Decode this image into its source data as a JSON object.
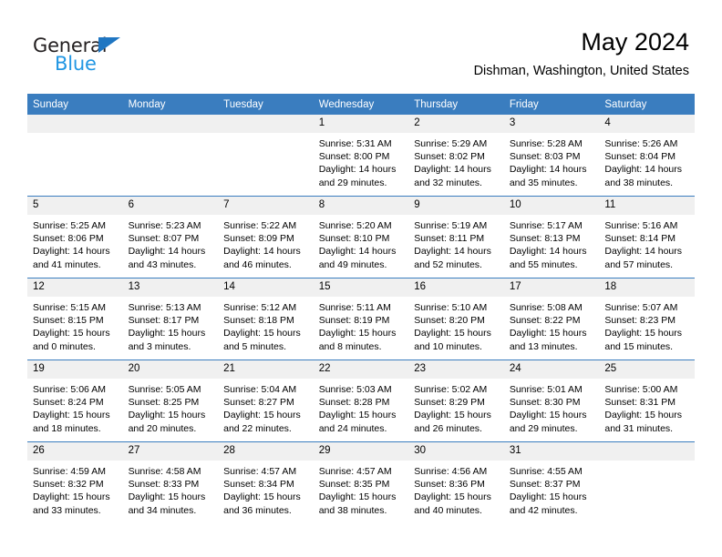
{
  "logo": {
    "text_primary": "General",
    "text_secondary": "Blue",
    "triangle_color": "#1f76c2",
    "secondary_color": "#2196e3"
  },
  "header": {
    "title": "May 2024",
    "subtitle": "Dishman, Washington, United States"
  },
  "theme": {
    "header_row_bg": "#3a7dbf",
    "day_number_bg": "#f0f0f0",
    "grid_line": "#3a7dbf",
    "text": "#000000"
  },
  "calendar": {
    "weekday_headers": [
      "Sunday",
      "Monday",
      "Tuesday",
      "Wednesday",
      "Thursday",
      "Friday",
      "Saturday"
    ],
    "weeks": [
      [
        {
          "day": "",
          "sunrise": "",
          "sunset": "",
          "daylight_line1": "",
          "daylight_line2": ""
        },
        {
          "day": "",
          "sunrise": "",
          "sunset": "",
          "daylight_line1": "",
          "daylight_line2": ""
        },
        {
          "day": "",
          "sunrise": "",
          "sunset": "",
          "daylight_line1": "",
          "daylight_line2": ""
        },
        {
          "day": "1",
          "sunrise": "Sunrise: 5:31 AM",
          "sunset": "Sunset: 8:00 PM",
          "daylight_line1": "Daylight: 14 hours",
          "daylight_line2": "and 29 minutes."
        },
        {
          "day": "2",
          "sunrise": "Sunrise: 5:29 AM",
          "sunset": "Sunset: 8:02 PM",
          "daylight_line1": "Daylight: 14 hours",
          "daylight_line2": "and 32 minutes."
        },
        {
          "day": "3",
          "sunrise": "Sunrise: 5:28 AM",
          "sunset": "Sunset: 8:03 PM",
          "daylight_line1": "Daylight: 14 hours",
          "daylight_line2": "and 35 minutes."
        },
        {
          "day": "4",
          "sunrise": "Sunrise: 5:26 AM",
          "sunset": "Sunset: 8:04 PM",
          "daylight_line1": "Daylight: 14 hours",
          "daylight_line2": "and 38 minutes."
        }
      ],
      [
        {
          "day": "5",
          "sunrise": "Sunrise: 5:25 AM",
          "sunset": "Sunset: 8:06 PM",
          "daylight_line1": "Daylight: 14 hours",
          "daylight_line2": "and 41 minutes."
        },
        {
          "day": "6",
          "sunrise": "Sunrise: 5:23 AM",
          "sunset": "Sunset: 8:07 PM",
          "daylight_line1": "Daylight: 14 hours",
          "daylight_line2": "and 43 minutes."
        },
        {
          "day": "7",
          "sunrise": "Sunrise: 5:22 AM",
          "sunset": "Sunset: 8:09 PM",
          "daylight_line1": "Daylight: 14 hours",
          "daylight_line2": "and 46 minutes."
        },
        {
          "day": "8",
          "sunrise": "Sunrise: 5:20 AM",
          "sunset": "Sunset: 8:10 PM",
          "daylight_line1": "Daylight: 14 hours",
          "daylight_line2": "and 49 minutes."
        },
        {
          "day": "9",
          "sunrise": "Sunrise: 5:19 AM",
          "sunset": "Sunset: 8:11 PM",
          "daylight_line1": "Daylight: 14 hours",
          "daylight_line2": "and 52 minutes."
        },
        {
          "day": "10",
          "sunrise": "Sunrise: 5:17 AM",
          "sunset": "Sunset: 8:13 PM",
          "daylight_line1": "Daylight: 14 hours",
          "daylight_line2": "and 55 minutes."
        },
        {
          "day": "11",
          "sunrise": "Sunrise: 5:16 AM",
          "sunset": "Sunset: 8:14 PM",
          "daylight_line1": "Daylight: 14 hours",
          "daylight_line2": "and 57 minutes."
        }
      ],
      [
        {
          "day": "12",
          "sunrise": "Sunrise: 5:15 AM",
          "sunset": "Sunset: 8:15 PM",
          "daylight_line1": "Daylight: 15 hours",
          "daylight_line2": "and 0 minutes."
        },
        {
          "day": "13",
          "sunrise": "Sunrise: 5:13 AM",
          "sunset": "Sunset: 8:17 PM",
          "daylight_line1": "Daylight: 15 hours",
          "daylight_line2": "and 3 minutes."
        },
        {
          "day": "14",
          "sunrise": "Sunrise: 5:12 AM",
          "sunset": "Sunset: 8:18 PM",
          "daylight_line1": "Daylight: 15 hours",
          "daylight_line2": "and 5 minutes."
        },
        {
          "day": "15",
          "sunrise": "Sunrise: 5:11 AM",
          "sunset": "Sunset: 8:19 PM",
          "daylight_line1": "Daylight: 15 hours",
          "daylight_line2": "and 8 minutes."
        },
        {
          "day": "16",
          "sunrise": "Sunrise: 5:10 AM",
          "sunset": "Sunset: 8:20 PM",
          "daylight_line1": "Daylight: 15 hours",
          "daylight_line2": "and 10 minutes."
        },
        {
          "day": "17",
          "sunrise": "Sunrise: 5:08 AM",
          "sunset": "Sunset: 8:22 PM",
          "daylight_line1": "Daylight: 15 hours",
          "daylight_line2": "and 13 minutes."
        },
        {
          "day": "18",
          "sunrise": "Sunrise: 5:07 AM",
          "sunset": "Sunset: 8:23 PM",
          "daylight_line1": "Daylight: 15 hours",
          "daylight_line2": "and 15 minutes."
        }
      ],
      [
        {
          "day": "19",
          "sunrise": "Sunrise: 5:06 AM",
          "sunset": "Sunset: 8:24 PM",
          "daylight_line1": "Daylight: 15 hours",
          "daylight_line2": "and 18 minutes."
        },
        {
          "day": "20",
          "sunrise": "Sunrise: 5:05 AM",
          "sunset": "Sunset: 8:25 PM",
          "daylight_line1": "Daylight: 15 hours",
          "daylight_line2": "and 20 minutes."
        },
        {
          "day": "21",
          "sunrise": "Sunrise: 5:04 AM",
          "sunset": "Sunset: 8:27 PM",
          "daylight_line1": "Daylight: 15 hours",
          "daylight_line2": "and 22 minutes."
        },
        {
          "day": "22",
          "sunrise": "Sunrise: 5:03 AM",
          "sunset": "Sunset: 8:28 PM",
          "daylight_line1": "Daylight: 15 hours",
          "daylight_line2": "and 24 minutes."
        },
        {
          "day": "23",
          "sunrise": "Sunrise: 5:02 AM",
          "sunset": "Sunset: 8:29 PM",
          "daylight_line1": "Daylight: 15 hours",
          "daylight_line2": "and 26 minutes."
        },
        {
          "day": "24",
          "sunrise": "Sunrise: 5:01 AM",
          "sunset": "Sunset: 8:30 PM",
          "daylight_line1": "Daylight: 15 hours",
          "daylight_line2": "and 29 minutes."
        },
        {
          "day": "25",
          "sunrise": "Sunrise: 5:00 AM",
          "sunset": "Sunset: 8:31 PM",
          "daylight_line1": "Daylight: 15 hours",
          "daylight_line2": "and 31 minutes."
        }
      ],
      [
        {
          "day": "26",
          "sunrise": "Sunrise: 4:59 AM",
          "sunset": "Sunset: 8:32 PM",
          "daylight_line1": "Daylight: 15 hours",
          "daylight_line2": "and 33 minutes."
        },
        {
          "day": "27",
          "sunrise": "Sunrise: 4:58 AM",
          "sunset": "Sunset: 8:33 PM",
          "daylight_line1": "Daylight: 15 hours",
          "daylight_line2": "and 34 minutes."
        },
        {
          "day": "28",
          "sunrise": "Sunrise: 4:57 AM",
          "sunset": "Sunset: 8:34 PM",
          "daylight_line1": "Daylight: 15 hours",
          "daylight_line2": "and 36 minutes."
        },
        {
          "day": "29",
          "sunrise": "Sunrise: 4:57 AM",
          "sunset": "Sunset: 8:35 PM",
          "daylight_line1": "Daylight: 15 hours",
          "daylight_line2": "and 38 minutes."
        },
        {
          "day": "30",
          "sunrise": "Sunrise: 4:56 AM",
          "sunset": "Sunset: 8:36 PM",
          "daylight_line1": "Daylight: 15 hours",
          "daylight_line2": "and 40 minutes."
        },
        {
          "day": "31",
          "sunrise": "Sunrise: 4:55 AM",
          "sunset": "Sunset: 8:37 PM",
          "daylight_line1": "Daylight: 15 hours",
          "daylight_line2": "and 42 minutes."
        },
        {
          "day": "",
          "sunrise": "",
          "sunset": "",
          "daylight_line1": "",
          "daylight_line2": ""
        }
      ]
    ]
  }
}
